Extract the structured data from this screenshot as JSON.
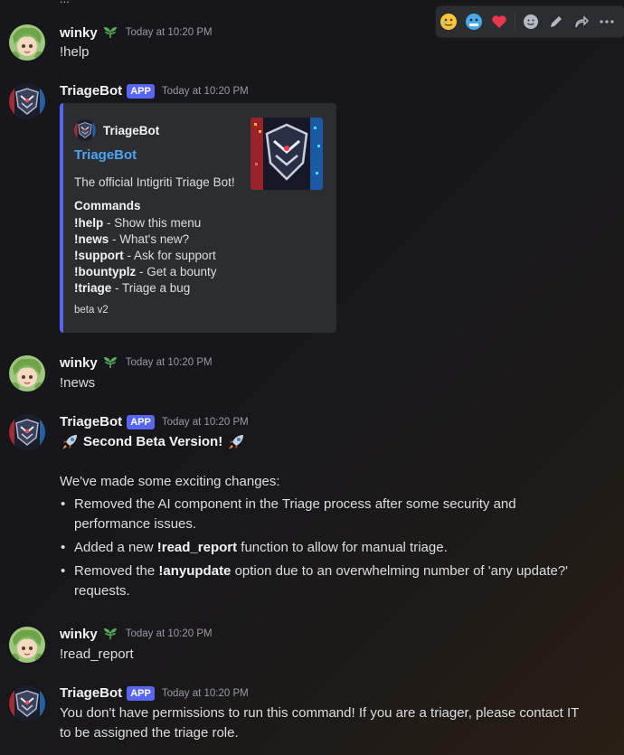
{
  "channel_topbar": "...",
  "hover_toolbar": {
    "reactions": [
      "face-holding-back-tears",
      "cold-face",
      "red-heart"
    ],
    "actions": [
      "add-reaction",
      "edit",
      "forward",
      "more"
    ]
  },
  "messages": [
    {
      "author": "winky",
      "time": "Today at 10:20 PM",
      "content": "!help"
    },
    {
      "author": "TriageBot",
      "badge": "APP",
      "time": "Today at 10:20 PM",
      "embed": {
        "author": "TriageBot",
        "title": "TriageBot",
        "description": "The official Intigriti Triage Bot!",
        "field_name": "Commands",
        "commands": [
          {
            "cmd": "!help",
            "desc": " - Show this menu"
          },
          {
            "cmd": "!news",
            "desc": " - What's new?"
          },
          {
            "cmd": "!support",
            "desc": " - Ask for support"
          },
          {
            "cmd": "!bountyplz",
            "desc": " - Get a bounty"
          },
          {
            "cmd": "!triage",
            "desc": " - Triage a bug"
          }
        ],
        "footer": "beta v2",
        "accent_color": "#5865f2"
      }
    },
    {
      "author": "winky",
      "time": "Today at 10:20 PM",
      "content": "!news"
    },
    {
      "author": "TriageBot",
      "badge": "APP",
      "time": "Today at 10:20 PM",
      "heading": "Second Beta Version!",
      "intro": "We've made some exciting changes:",
      "bullets": [
        {
          "pre": "Removed the AI component in the Triage process after some security and",
          "pre2": "performance issues.",
          "bold": "",
          "post": ""
        },
        {
          "pre": "Added a new ",
          "bold": "!read_report",
          "post": " function to allow for manual triage."
        },
        {
          "pre": "Removed the ",
          "bold": "!anyupdate",
          "post": " option due to an overwhelming number of 'any update?'",
          "post2": "requests."
        }
      ]
    },
    {
      "author": "winky",
      "time": "Today at 10:20 PM",
      "content": "!read_report"
    },
    {
      "author": "TriageBot",
      "badge": "APP",
      "time": "Today at 10:20 PM",
      "content": "You don't have permissions to run this command! If you are a triager, please contact IT",
      "content2": "to be assigned the triage role."
    }
  ]
}
